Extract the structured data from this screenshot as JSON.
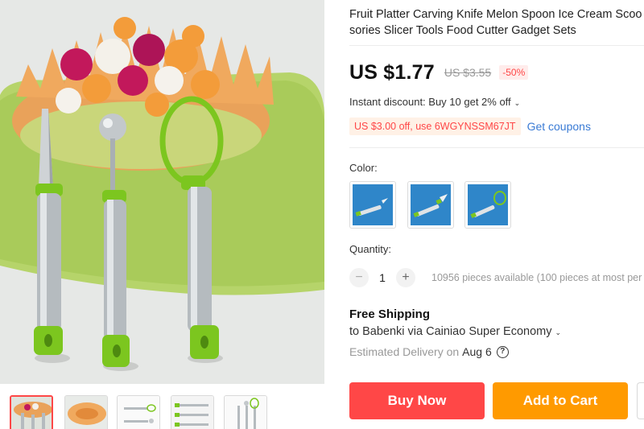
{
  "product": {
    "title_line1": "Fruit Platter Carving Knife Melon Spoon Ice Cream Scoo",
    "title_line2": "sories Slicer Tools Food Cutter Gadget Sets"
  },
  "pricing": {
    "price": "US $1.77",
    "old_price": "US $3.55",
    "discount": "-50%"
  },
  "promo": {
    "instant_discount": "Instant discount: Buy 10 get 2% off",
    "coupon_code": "US $3.00 off, use 6WGYNSSM67JT",
    "get_coupons": "Get coupons"
  },
  "color": {
    "label": "Color:",
    "options": [
      "knife-blue-bg",
      "carver-blue-bg",
      "ring-blue-bg"
    ]
  },
  "quantity": {
    "label": "Quantity:",
    "minus": "−",
    "value": "1",
    "plus": "+",
    "available": "10956 pieces available (100 pieces at most per cu"
  },
  "shipping": {
    "title": "Free Shipping",
    "to": "to Babenki via Cainiao Super Economy",
    "estimated_label": "Estimated Delivery on",
    "estimated_date": "Aug 6",
    "help": "?"
  },
  "actions": {
    "buy_now": "Buy Now",
    "add_to_cart": "Add to Cart"
  },
  "icons": {
    "chevron": "chevron-down-icon",
    "help": "question-circle-icon"
  },
  "colors": {
    "accent_red": "#ff4747",
    "accent_orange": "#ff9a00",
    "link_blue": "#3a7bd5",
    "tool_green": "#7cc61f"
  }
}
